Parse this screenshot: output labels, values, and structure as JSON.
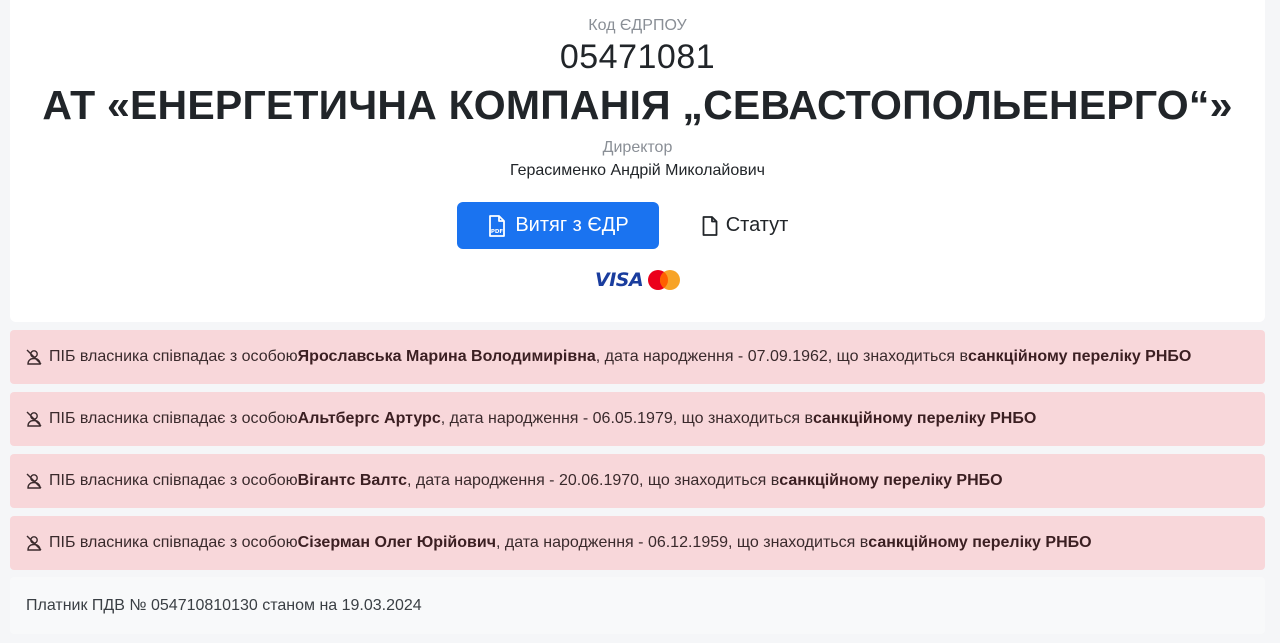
{
  "company": {
    "code_label": "Код ЄДРПОУ",
    "code_value": "05471081",
    "name": "АТ «ЕНЕРГЕТИЧНА КОМПАНІЯ „СЕВАСТОПОЛЬЕНЕРГО“»",
    "director_label": "Директор",
    "director_name": "Герасименко Андрій Миколайович"
  },
  "actions": {
    "edr_button": "Витяг з ЄДР",
    "statut_button": "Статут",
    "payment_visa": "VISA"
  },
  "sanctions": [
    {
      "prefix": "ПІБ власника співпадає з особою ",
      "person": "Ярославська Марина Володимирівна",
      "middle": ", дата народження - 07.09.1962, що знаходиться в ",
      "list": "санкційному переліку РНБО"
    },
    {
      "prefix": "ПІБ власника співпадає з особою ",
      "person": "Альтбергс Артурс",
      "middle": ", дата народження - 06.05.1979, що знаходиться в ",
      "list": "санкційному переліку РНБО"
    },
    {
      "prefix": "ПІБ власника співпадає з особою ",
      "person": "Вігантс Валтс",
      "middle": ", дата народження - 20.06.1970, що знаходиться в ",
      "list": "санкційному переліку РНБО"
    },
    {
      "prefix": "ПІБ власника співпадає з особою ",
      "person": "Сізерман Олег Юрійович",
      "middle": ", дата народження - 06.12.1959, що знаходиться в ",
      "list": "санкційному переліку РНБО"
    }
  ],
  "vat": {
    "text": "Платник ПДВ № 054710810130 станом на 19.03.2024"
  },
  "icons": {
    "edr": "pdf-file-icon",
    "statut": "document-icon",
    "alert": "user-slash-icon"
  },
  "colors": {
    "primary": "#1a73f0",
    "alert_bg": "#f8d7da",
    "visa": "#1a3d9e"
  }
}
